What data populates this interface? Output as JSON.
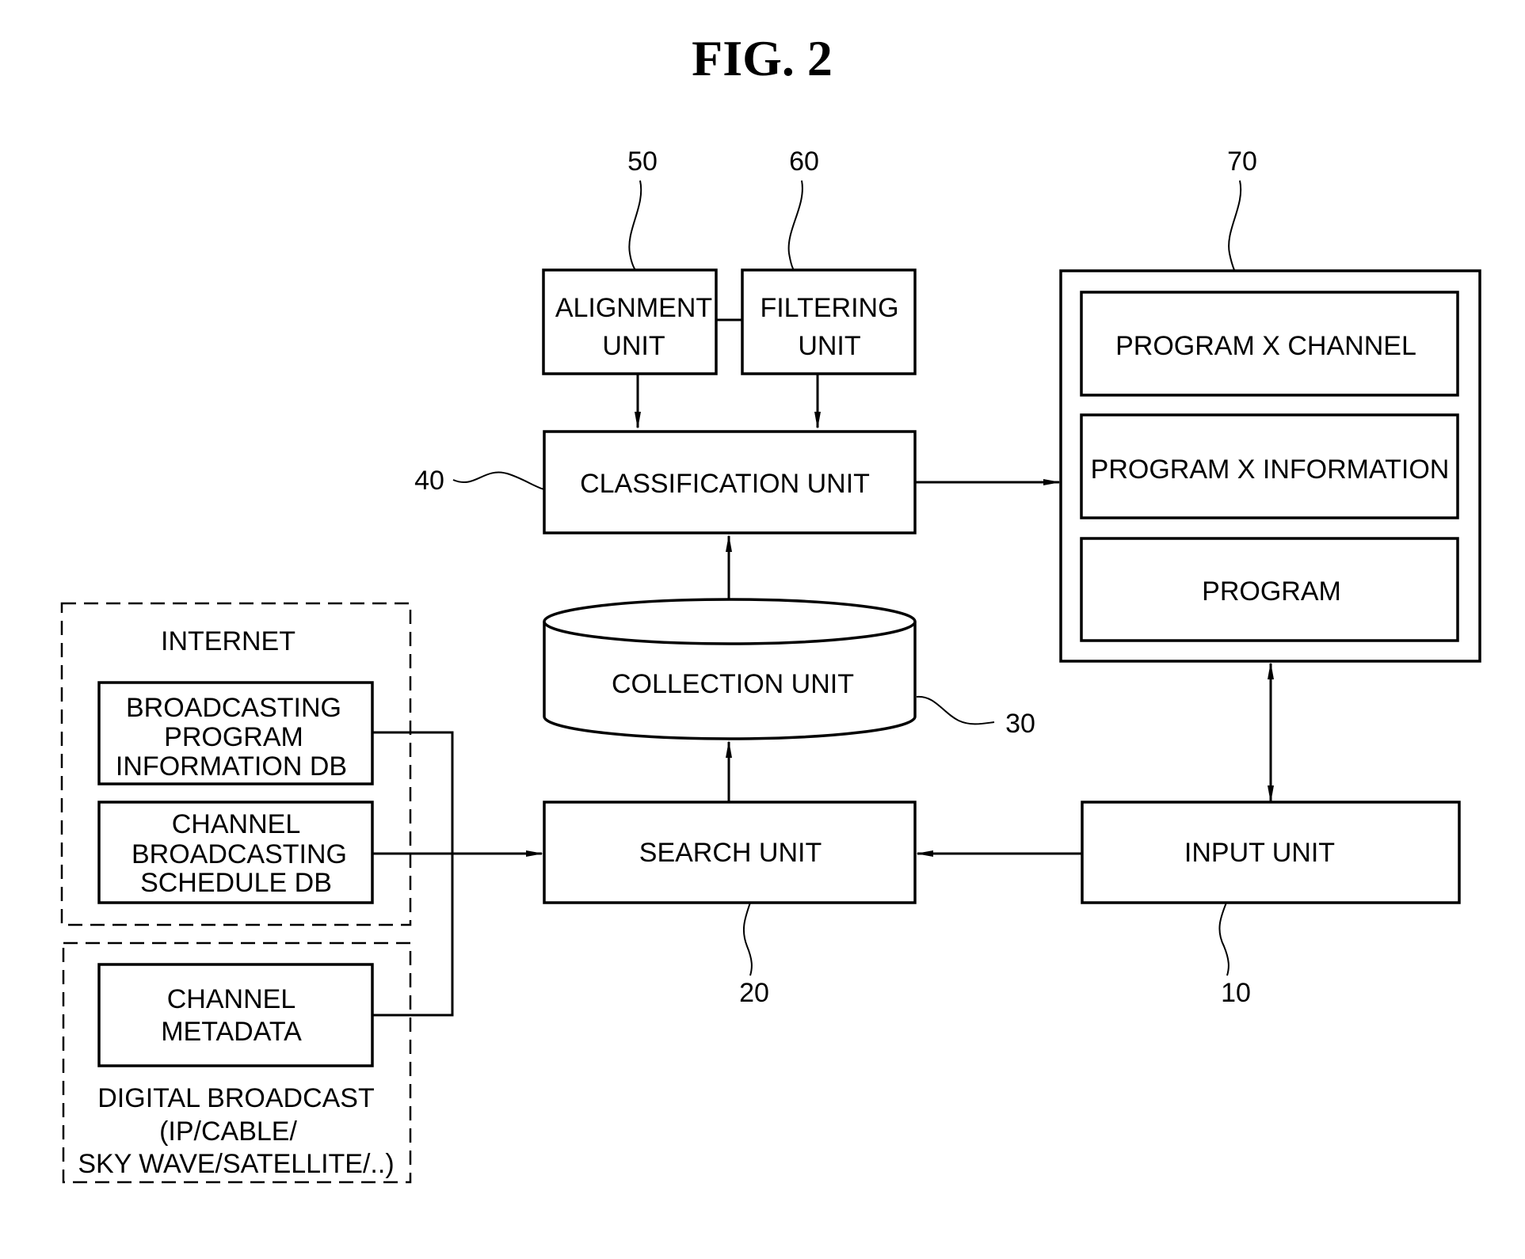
{
  "figure": {
    "title": "FIG. 2"
  },
  "blocks": {
    "alignment": {
      "lines": [
        "ALIGNMENT",
        "UNIT"
      ],
      "ref": "50"
    },
    "filtering": {
      "lines": [
        "FILTERING",
        "UNIT"
      ],
      "ref": "60"
    },
    "classification": {
      "lines": [
        "CLASSIFICATION UNIT"
      ],
      "ref": "40"
    },
    "collection": {
      "lines": [
        "COLLECTION UNIT"
      ],
      "ref": "30"
    },
    "search": {
      "lines": [
        "SEARCH UNIT"
      ],
      "ref": "20"
    },
    "input": {
      "lines": [
        "INPUT UNIT"
      ],
      "ref": "10"
    },
    "display": {
      "ref": "70",
      "items": [
        "PROGRAM X CHANNEL",
        "PROGRAM X INFORMATION",
        "PROGRAM"
      ]
    },
    "internet": {
      "label": "INTERNET",
      "bpi": [
        "BROADCASTING",
        "PROGRAM",
        "INFORMATION DB"
      ],
      "cbs": [
        "CHANNEL",
        "BROADCASTING",
        "SCHEDULE DB"
      ]
    },
    "digital": {
      "meta": [
        "CHANNEL",
        "METADATA"
      ],
      "label": [
        "DIGITAL BROADCAST",
        "(IP/CABLE/",
        "SKY WAVE/SATELLITE/..)"
      ]
    }
  }
}
